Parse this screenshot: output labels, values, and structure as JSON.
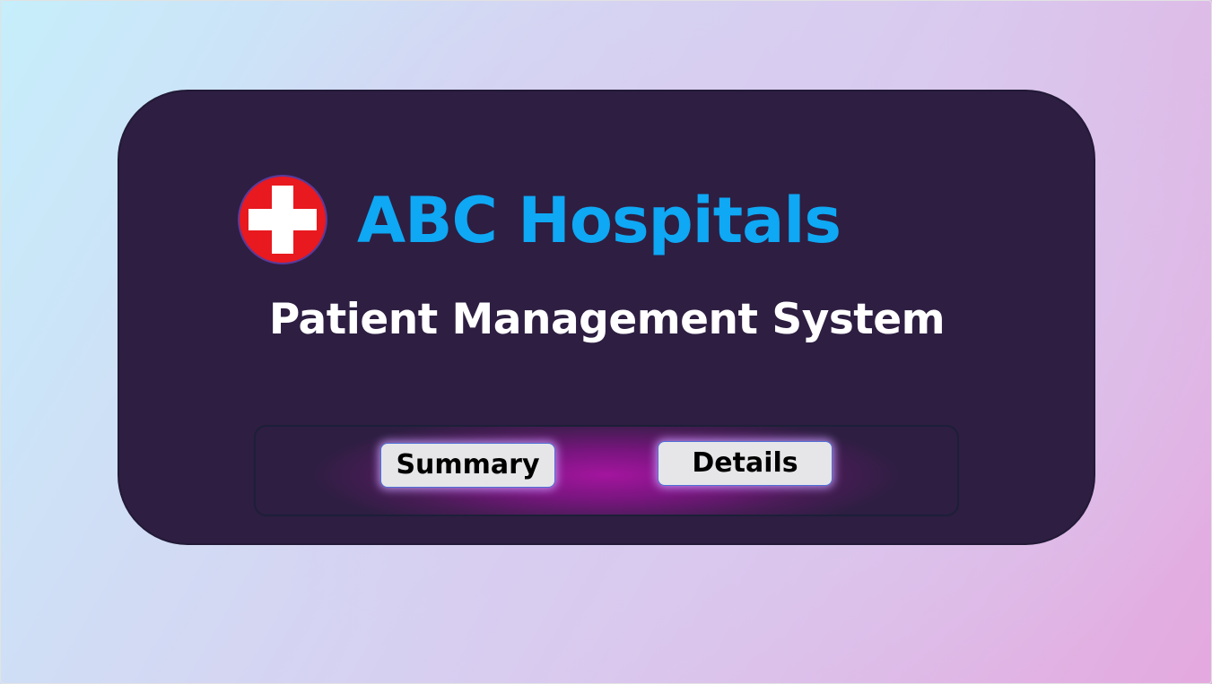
{
  "header": {
    "brand_title": "ABC Hospitals",
    "subtitle": "Patient Management System",
    "logo_icon": "red-cross-icon"
  },
  "actions": {
    "summary_label": "Summary",
    "details_label": "Details"
  },
  "colors": {
    "card_background": "#2e1e42",
    "brand_blue": "#0ea8f4",
    "logo_red": "#e8191f",
    "bar_glow": "#a3159e",
    "button_background": "#e6e6e9"
  }
}
